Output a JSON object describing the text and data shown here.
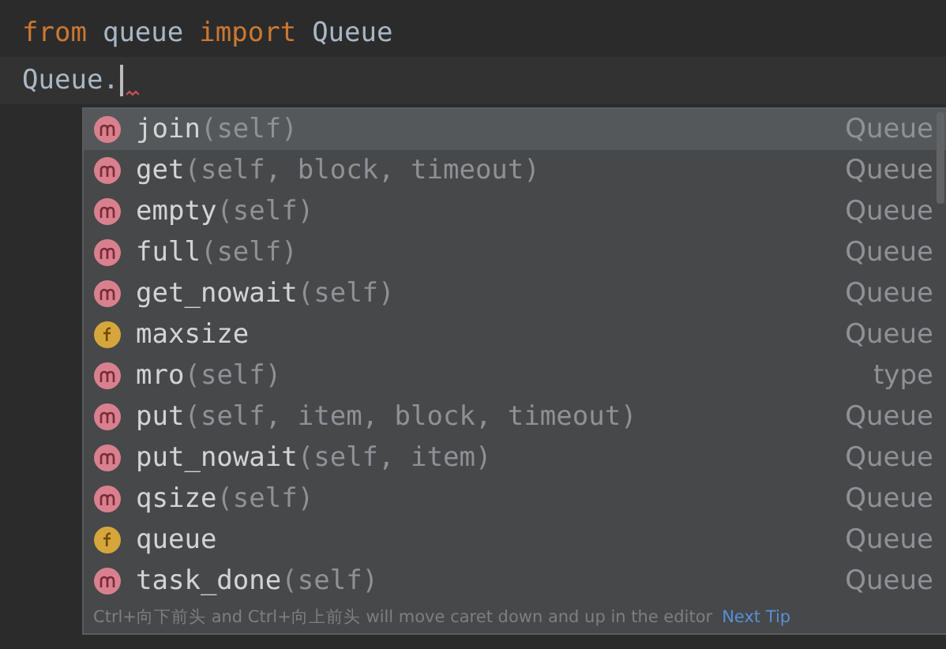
{
  "editor": {
    "lines": [
      {
        "tokens": [
          {
            "kind": "keyword",
            "text": "from"
          },
          {
            "kind": "plain",
            "text": "queue"
          },
          {
            "kind": "keyword",
            "text": "import"
          },
          {
            "kind": "plain",
            "text": "Queue"
          }
        ],
        "current": false
      },
      {
        "tokens": [
          {
            "kind": "plain",
            "text": "Queue."
          }
        ],
        "current": true
      }
    ]
  },
  "completion": {
    "items": [
      {
        "kind": "method",
        "name": "join",
        "params": "(self)",
        "type": "Queue",
        "selected": true
      },
      {
        "kind": "method",
        "name": "get",
        "params": "(self, block, timeout)",
        "type": "Queue",
        "selected": false
      },
      {
        "kind": "method",
        "name": "empty",
        "params": "(self)",
        "type": "Queue",
        "selected": false
      },
      {
        "kind": "method",
        "name": "full",
        "params": "(self)",
        "type": "Queue",
        "selected": false
      },
      {
        "kind": "method",
        "name": "get_nowait",
        "params": "(self)",
        "type": "Queue",
        "selected": false
      },
      {
        "kind": "field",
        "name": "maxsize",
        "type": "Queue",
        "selected": false
      },
      {
        "kind": "method",
        "name": "mro",
        "params": "(self)",
        "type": "type",
        "selected": false
      },
      {
        "kind": "method",
        "name": "put",
        "params": "(self, item, block, timeout)",
        "type": "Queue",
        "selected": false
      },
      {
        "kind": "method",
        "name": "put_nowait",
        "params": "(self, item)",
        "type": "Queue",
        "selected": false
      },
      {
        "kind": "method",
        "name": "qsize",
        "params": "(self)",
        "type": "Queue",
        "selected": false
      },
      {
        "kind": "field",
        "name": "queue",
        "type": "Queue",
        "selected": false
      },
      {
        "kind": "method",
        "name": "task_done",
        "params": "(self)",
        "type": "Queue",
        "selected": false
      }
    ],
    "hint": "Ctrl+向下前头 and Ctrl+向上前头 will move caret down and up in the editor",
    "link": "Next Tip"
  }
}
